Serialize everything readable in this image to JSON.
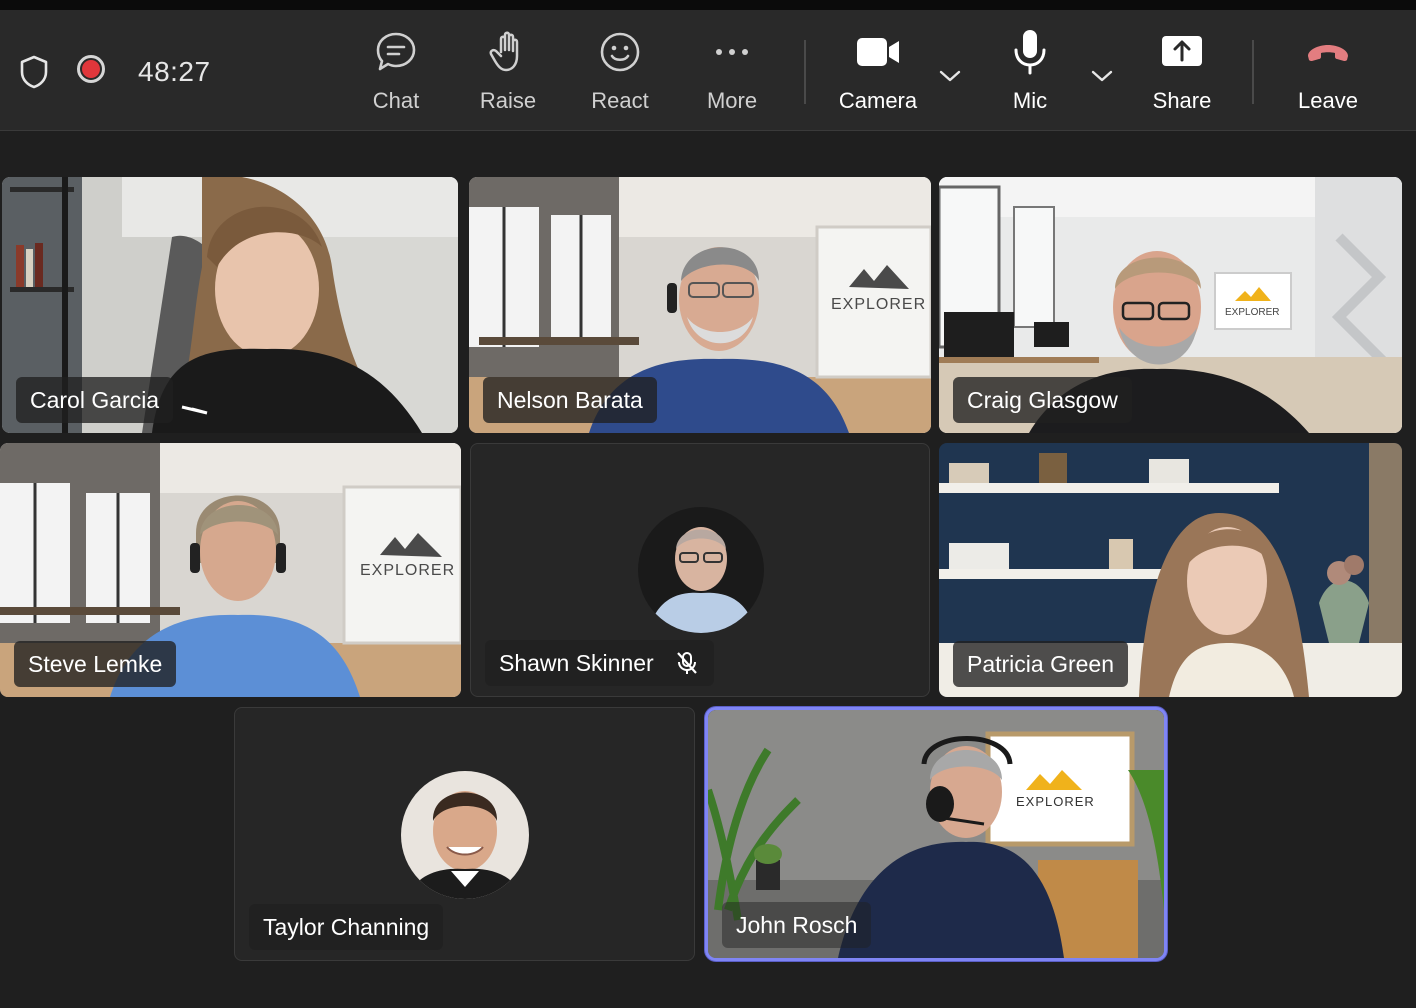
{
  "toolbar": {
    "timer": "48:27",
    "buttons": [
      {
        "label": "Chat",
        "icon": "chat-icon"
      },
      {
        "label": "Raise",
        "icon": "raise-hand-icon"
      },
      {
        "label": "React",
        "icon": "react-smile-icon"
      },
      {
        "label": "More",
        "icon": "more-dots-icon"
      },
      {
        "label": "Camera",
        "icon": "camera-icon"
      },
      {
        "label": "Mic",
        "icon": "mic-icon"
      },
      {
        "label": "Share",
        "icon": "share-icon"
      },
      {
        "label": "Leave",
        "icon": "leave-phone-icon"
      }
    ],
    "leave_color": "#e37d80",
    "record_color": "#e0363b"
  },
  "participants": [
    {
      "name": "Carol Garcia"
    },
    {
      "name": "Nelson Barata"
    },
    {
      "name": "Craig Glasgow"
    },
    {
      "name": "Steve Lemke"
    },
    {
      "name": "Shawn Skinner",
      "muted": true
    },
    {
      "name": "Patricia Green"
    },
    {
      "name": "Taylor Channing"
    },
    {
      "name": "John Rosch",
      "active_speaker": true
    }
  ],
  "backgrounds": {
    "explorer_logo_text": "EXPLORER"
  },
  "colors": {
    "active_speaker_border": "#7f85f5",
    "explorer_logo_yellow": "#f0b21b"
  }
}
